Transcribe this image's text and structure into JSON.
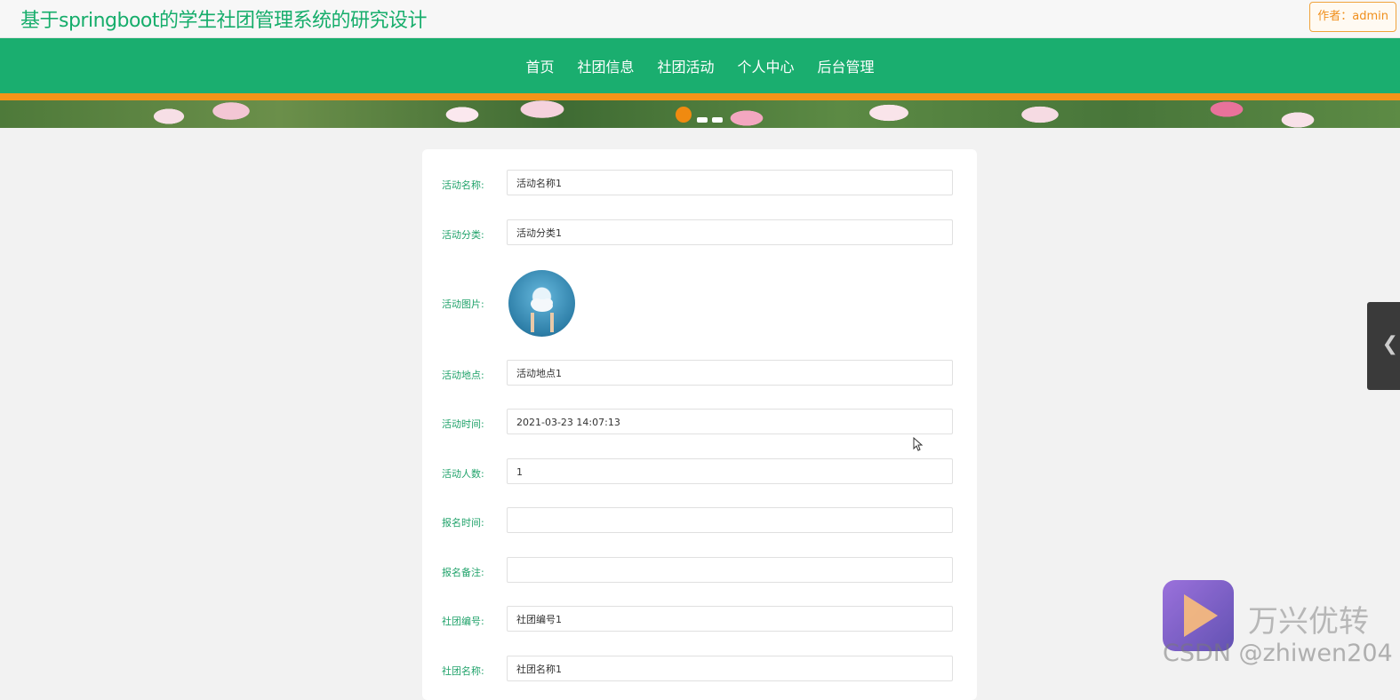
{
  "header": {
    "site_title": "基于springboot的学生社团管理系统的研究设计",
    "author_badge": "作者：admin"
  },
  "nav": {
    "items": [
      {
        "label": "首页"
      },
      {
        "label": "社团信息"
      },
      {
        "label": "社团活动"
      },
      {
        "label": "个人中心"
      },
      {
        "label": "后台管理"
      }
    ]
  },
  "colors": {
    "brand_green": "#1aae6f",
    "accent_orange": "#f39418",
    "label_green": "#21a36b"
  },
  "banner": {
    "carousel_dot_count": 3,
    "active_dot": 1
  },
  "form": {
    "fields": [
      {
        "label": "活动名称:",
        "value": "活动名称1"
      },
      {
        "label": "活动分类:",
        "value": "活动分类1"
      },
      {
        "label": "活动图片:",
        "value": "",
        "type": "image"
      },
      {
        "label": "活动地点:",
        "value": "活动地点1"
      },
      {
        "label": "活动时间:",
        "value": "2021-03-23 14:07:13"
      },
      {
        "label": "活动人数:",
        "value": "1"
      },
      {
        "label": "报名时间:",
        "value": ""
      },
      {
        "label": "报名备注:",
        "value": ""
      },
      {
        "label": "社团编号:",
        "value": "社团编号1"
      },
      {
        "label": "社团名称:",
        "value": "社团名称1"
      }
    ]
  },
  "side_tab": {
    "icon": "chevron-left-icon"
  },
  "watermark": {
    "brand": "万兴优转",
    "csdn": "CSDN @zhiwen204"
  }
}
